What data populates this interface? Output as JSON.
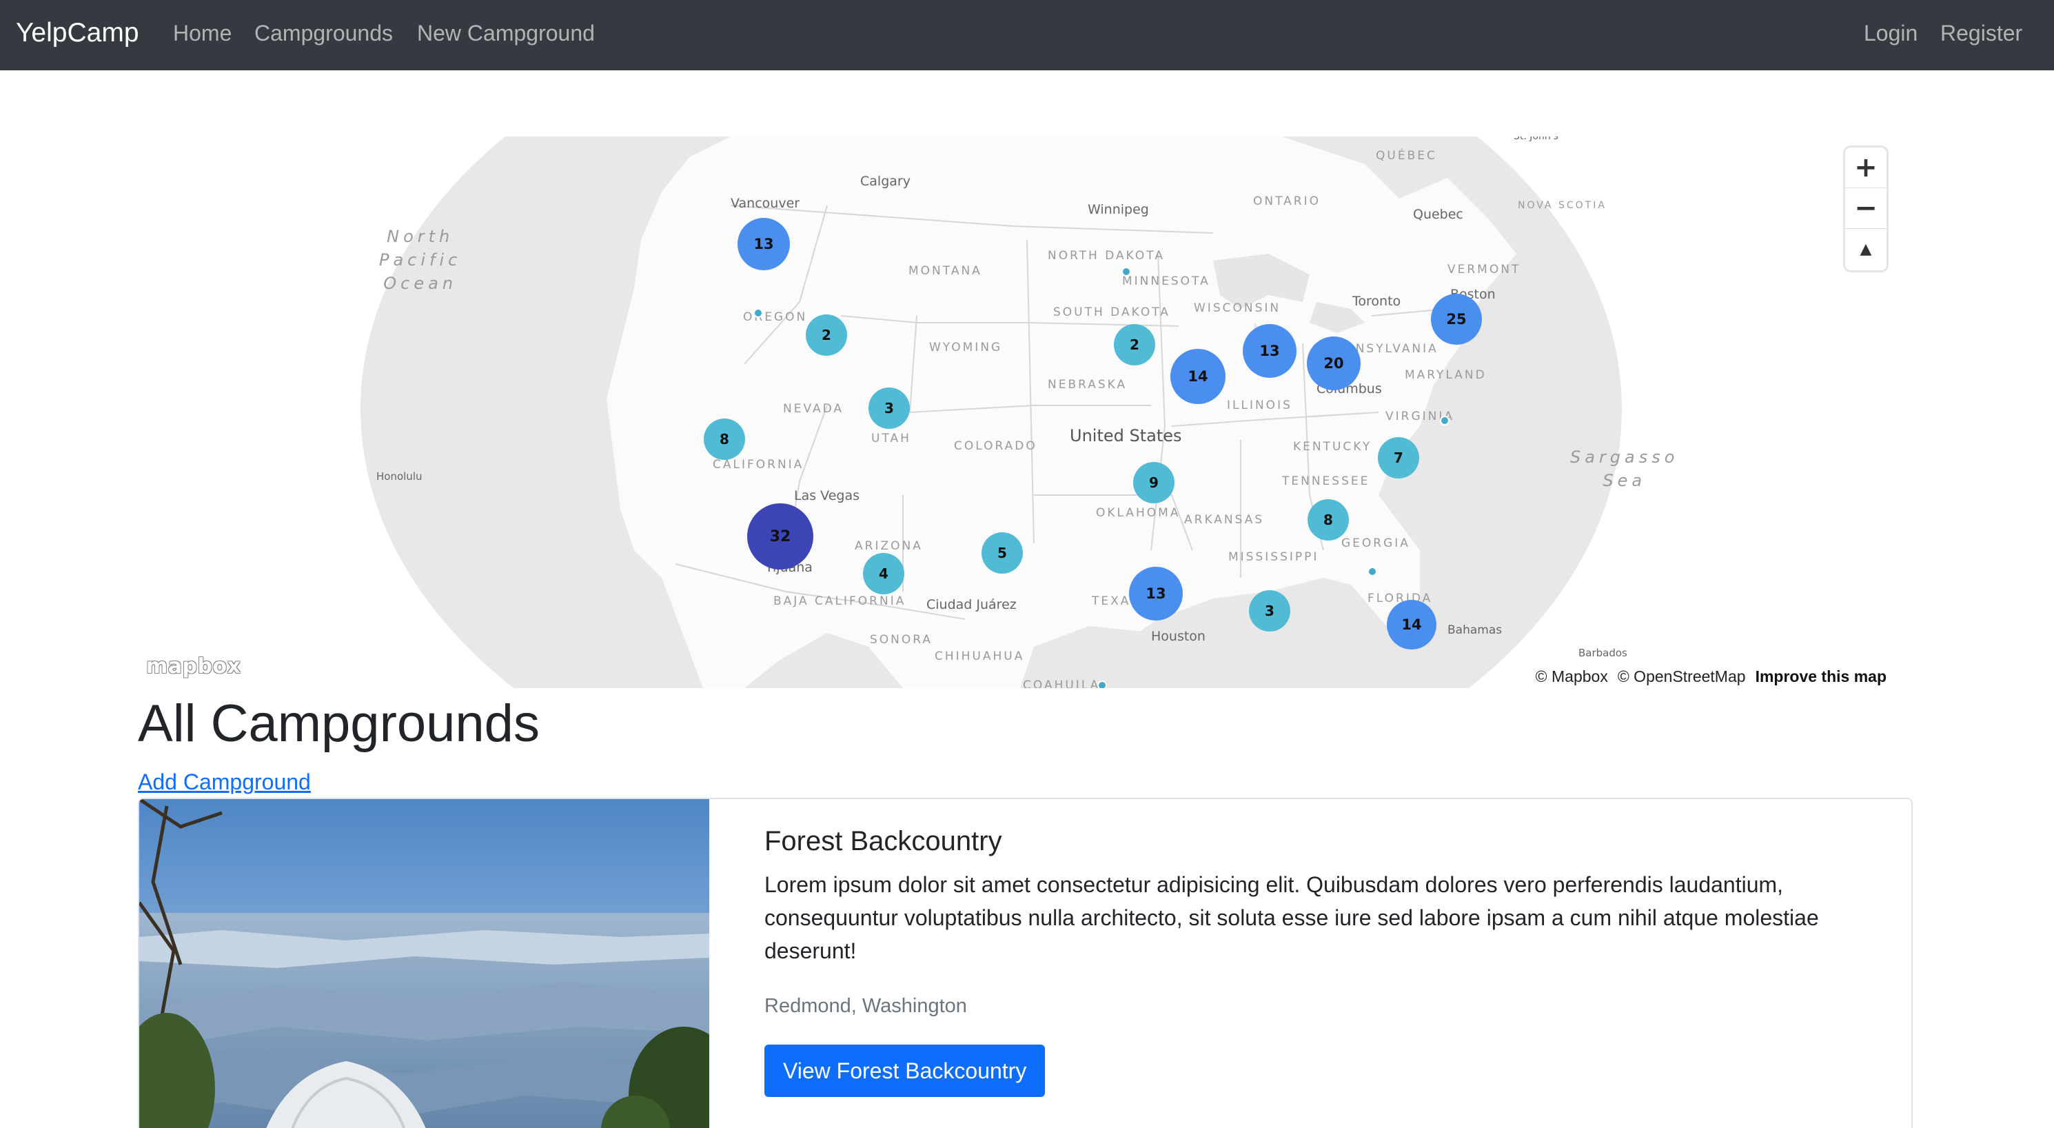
{
  "navbar": {
    "brand": "YelpCamp",
    "links": [
      "Home",
      "Campgrounds",
      "New Campground"
    ],
    "auth": [
      "Login",
      "Register"
    ]
  },
  "map": {
    "states": [
      "MONTANA",
      "NORTH DAKOTA",
      "SOUTH DAKOTA",
      "MINNESOTA",
      "WISCONSIN",
      "WYOMING",
      "NEBRASKA",
      "NEVADA",
      "UTAH",
      "COLORADO",
      "CALIFORNIA",
      "ARIZONA",
      "OKLAHOMA",
      "ARKANSAS",
      "TEXAS",
      "MISSISSIPPI",
      "GEORGIA",
      "FLORIDA",
      "TENNESSEE",
      "KENTUCKY",
      "VIRGINIA",
      "ILLINOIS",
      "OREGON",
      "PENNSYLVANIA",
      "MARYLAND",
      "VERMONT",
      "ONTARIO",
      "QUÉBEC",
      "NOVA SCOTIA",
      "BAJA CALIFORNIA",
      "SONORA",
      "CHIHUAHUA",
      "COAHUILA"
    ],
    "cities": [
      "Vancouver",
      "Calgary",
      "Winnipeg",
      "Quebec",
      "Boston",
      "Toronto",
      "Columbus",
      "Las Vegas",
      "Tijuana",
      "Ciudad Juárez",
      "Houston",
      "Honolulu",
      "Bahamas",
      "Barbados",
      "St. John's"
    ],
    "country": "United States",
    "oceans": [
      "North Pacific Ocean",
      "Sargasso Sea"
    ],
    "clusters": [
      "13",
      "2",
      "3",
      "8",
      "32",
      "4",
      "5",
      "2",
      "14",
      "13",
      "20",
      "25",
      "9",
      "7",
      "8",
      "13",
      "3",
      "14"
    ],
    "controls": [
      "+",
      "−",
      "▲"
    ],
    "logo": "mapbox",
    "attribution": [
      "© Mapbox",
      "© OpenStreetMap",
      "Improve this map"
    ]
  },
  "page": {
    "title": "All Campgrounds",
    "add_link": "Add Campground"
  },
  "campgrounds": [
    {
      "title": "Forest Backcountry",
      "description": "Lorem ipsum dolor sit amet consectetur adipisicing elit. Quibusdam dolores vero perferendis laudantium, consequuntur voluptatibus nulla architecto, sit soluta esse iure sed labore ipsam a cum nihil atque molestiae deserunt!",
      "location": "Redmond, Washington",
      "button": "View Forest Backcountry"
    }
  ],
  "colors": {
    "navbar": "#343a40",
    "cluster_small": "#51bbd6",
    "cluster_medium": "#4a8ff0",
    "cluster_large": "#3c45b5",
    "link": "#0d6efd",
    "button": "#0d6efd"
  }
}
